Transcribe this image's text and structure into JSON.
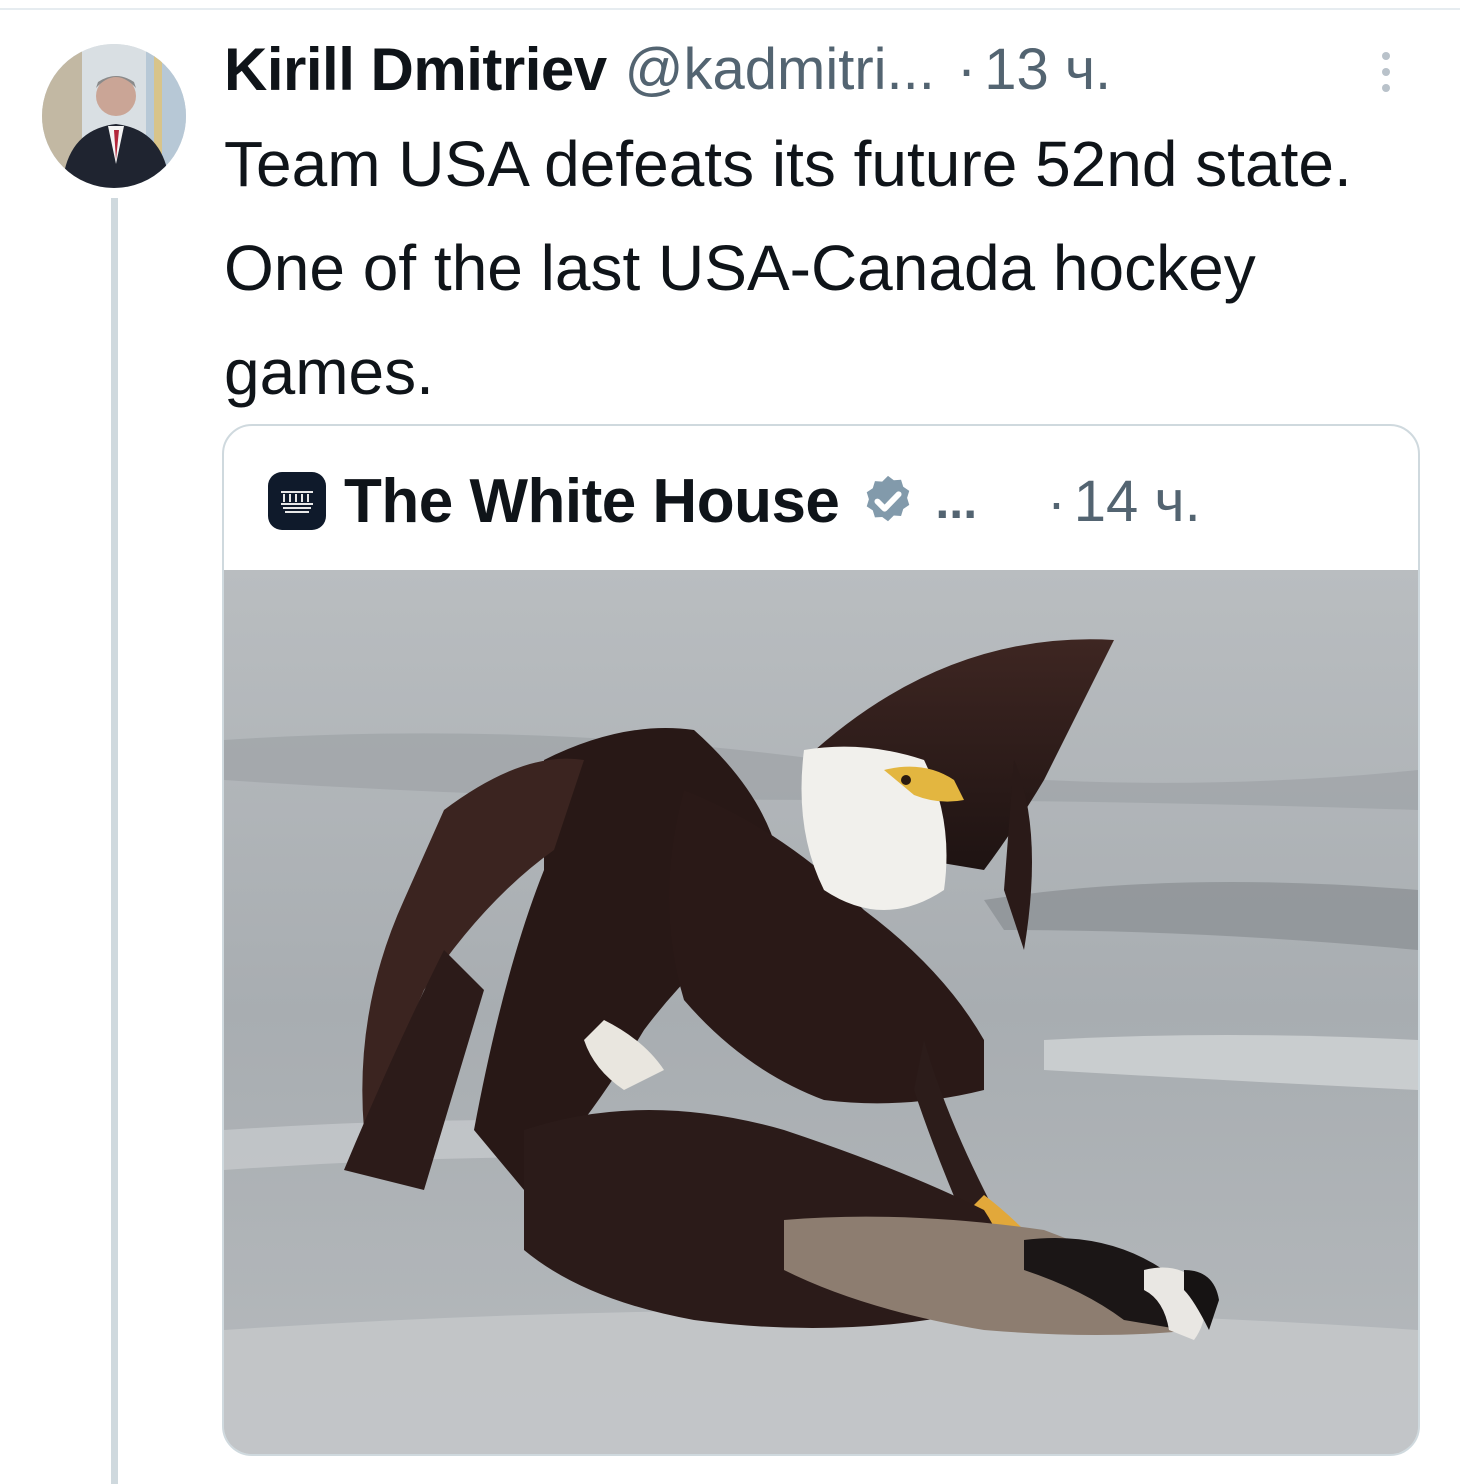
{
  "tweet": {
    "author_name": "Kirill Dmitriev",
    "author_handle": "@kadmitri...",
    "separator": "·",
    "time": "13 ч.",
    "text": "Team USA defeats its future 52nd state. One of the last USA-Canada hockey games."
  },
  "quoted_tweet": {
    "author_name": "The White House",
    "verified": true,
    "ellipsis": "...",
    "separator": "·",
    "time": "14 ч."
  },
  "icons": {
    "more": "more-vertical-icon",
    "verified": "verified-badge-icon"
  },
  "colors": {
    "secondary_text": "#536471",
    "verified_badge": "#829aab",
    "border": "#cfd9de"
  }
}
